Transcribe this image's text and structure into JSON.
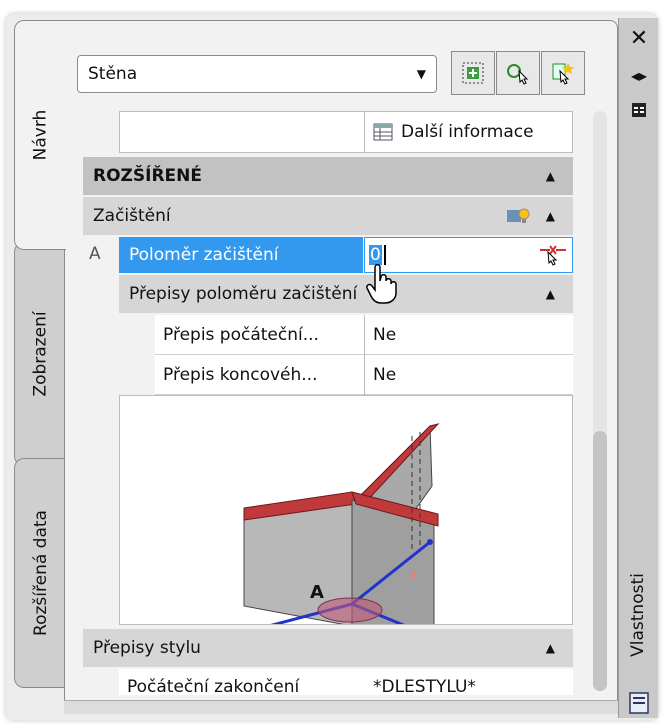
{
  "palette": {
    "selection": "#3399ee",
    "section_header": "#c2c2c2",
    "sub_header": "#d6d6d6",
    "panel_bg": "#f2f2f2",
    "wall_top": "#c0393b",
    "cleanup_line": "#2233cc"
  },
  "side_tabs": [
    "Návrh",
    "Zobrazení",
    "Rozšířená data"
  ],
  "right_bar": {
    "close_icon": "close-icon",
    "autohide_icon": "autohide-icon",
    "properties_icon": "properties-icon",
    "palette_title": "Vlastnosti"
  },
  "toolbar": {
    "object_type": "Stěna",
    "buttons": [
      "add-selected-icon",
      "select-objects-icon",
      "quick-select-icon"
    ]
  },
  "info_button": {
    "label": "Další informace",
    "icon": "table-icon"
  },
  "sections": {
    "advanced": {
      "label": "ROZŠÍŘENÉ"
    },
    "cleanup": {
      "label": "Začištění",
      "icon": "lightbulb-icon"
    },
    "radius": {
      "marker": "A",
      "label": "Poloměr začištění",
      "value": "0",
      "icon": "pick-point-icon"
    },
    "radius_overrides": {
      "label": "Přepisy poloměru začištění"
    },
    "start_override": {
      "label": "Přepis počáteční...",
      "value": "Ne"
    },
    "end_override": {
      "label": "Přepis koncovéh...",
      "value": "Ne"
    },
    "style_overrides": {
      "label": "Přepisy stylu"
    },
    "clipped_row": {
      "label": "Počáteční zakončení",
      "value": "*DLESTYLU*"
    }
  },
  "preview": {
    "marker": "A"
  }
}
